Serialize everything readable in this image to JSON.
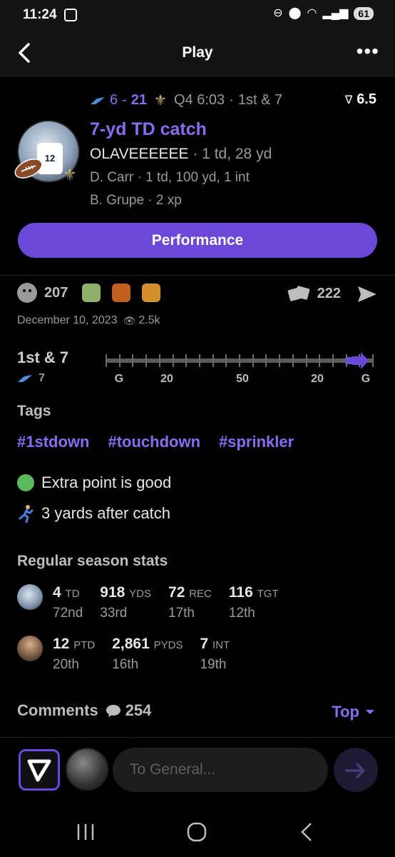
{
  "status_bar": {
    "time": "11:24",
    "battery": "61"
  },
  "header": {
    "title": "Play"
  },
  "play": {
    "away_score": "6",
    "home_score": "21",
    "quarter_clock": "Q4 6:03",
    "down": "1st & 7",
    "spread": "6.5",
    "title": "7-yd TD catch",
    "player_name": "OLAVEEEEEE",
    "player_stats": " · 1 td, 28 yd",
    "passer_line": "D. Carr · 1 td, 100 yd, 1 int",
    "kicker_line": "B. Grupe · 2 xp",
    "jersey_number": "12",
    "performance_label": "Performance"
  },
  "engagement": {
    "reactions_count": "207",
    "shares_count": "222",
    "date": "December 10, 2023",
    "views": "2.5k",
    "colors": {
      "react_1": "#8fb06a",
      "react_2": "#c0601e",
      "react_3": "#d4902a"
    }
  },
  "field": {
    "down_distance": "1st & 7",
    "yard_line": "7",
    "labels": [
      "G",
      "20",
      "50",
      "20",
      "G"
    ],
    "progress_fraction": 0.93
  },
  "tags": {
    "heading": "Tags",
    "items": [
      "#1stdown",
      "#touchdown",
      "#sprinkler"
    ]
  },
  "facts": [
    {
      "text": "Extra point is good",
      "icon": "green-circle-icon"
    },
    {
      "text": "3 yards after catch",
      "icon": "runner-icon"
    }
  ],
  "season_stats": {
    "heading": "Regular season stats",
    "rows": [
      {
        "cells": [
          {
            "value": "4",
            "unit": "TD",
            "rank": "72nd"
          },
          {
            "value": "918",
            "unit": "YDS",
            "rank": "33rd"
          },
          {
            "value": "72",
            "unit": "REC",
            "rank": "17th"
          },
          {
            "value": "116",
            "unit": "TGT",
            "rank": "12th"
          }
        ]
      },
      {
        "cells": [
          {
            "value": "12",
            "unit": "PTD",
            "rank": "20th"
          },
          {
            "value": "2,861",
            "unit": "PYDS",
            "rank": "16th"
          },
          {
            "value": "7",
            "unit": "INT",
            "rank": "19th"
          }
        ]
      }
    ]
  },
  "comments": {
    "label": "Comments",
    "count": "254",
    "sort_label": "Top"
  },
  "composer": {
    "placeholder": "To General..."
  },
  "colors": {
    "accent": "#6b48d8",
    "accent_text": "#8b6cf0",
    "background": "#000000"
  }
}
